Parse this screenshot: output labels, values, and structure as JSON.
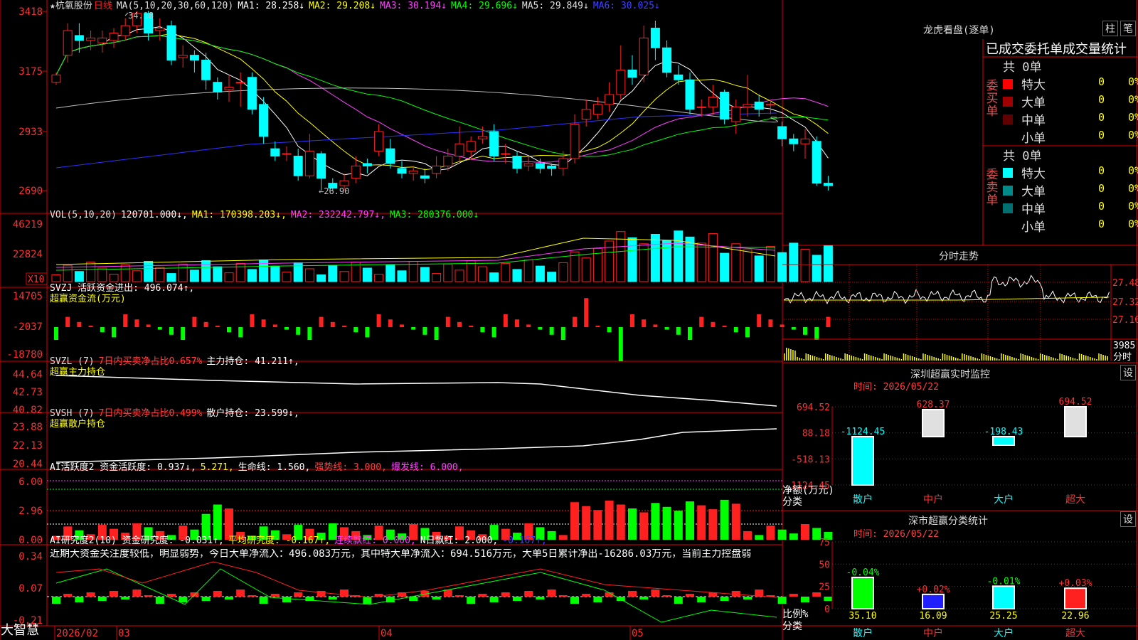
{
  "app": {
    "brand": "大智慧"
  },
  "header": {
    "stock": "★杭氧股份",
    "period": "日线",
    "ma_label": "MA(5,10,20,30,60,120)",
    "ma_values": [
      {
        "label": "MA1: 28.258↓",
        "color": "#ffffff"
      },
      {
        "label": "MA2: 29.208↓",
        "color": "#ffff00"
      },
      {
        "label": "MA3: 30.194↓",
        "color": "#ff40ff"
      },
      {
        "label": "MA4: 29.696↓",
        "color": "#00ff00"
      },
      {
        "label": "MA5: 29.849↓",
        "color": "#c0c0c0"
      },
      {
        "label": "MA6: 30.025↓",
        "color": "#4040ff"
      }
    ]
  },
  "price_axis": [
    "3418",
    "3175",
    "2933",
    "2690"
  ],
  "price_annotations": {
    "high": "34.18",
    "low": "←26.90"
  },
  "vol_pane": {
    "header": [
      {
        "label": "VOL(5,10,20)",
        "color": "#c0c0c0"
      },
      {
        "label": "120701.000↓,",
        "color": "#ffffff"
      },
      {
        "label": "MA1: 170398.203↓,",
        "color": "#ffff00"
      },
      {
        "label": "MA2: 232242.797↓,",
        "color": "#ff40ff"
      },
      {
        "label": "MA3: 280376.000↓",
        "color": "#00ff00"
      }
    ],
    "axis": [
      "46219",
      "22824"
    ],
    "unit": "X10"
  },
  "svzj_pane": {
    "header": [
      {
        "label": "SVZJ  活跃资金进出: 496.074↑,",
        "color": "#ffffff"
      }
    ],
    "subtitle": "超赢资金流(万元)",
    "axis": [
      "14705",
      "-2037",
      "-18780"
    ]
  },
  "svzl_pane": {
    "header": [
      {
        "label": "SVZL (7)",
        "color": "#c0c0c0"
      },
      {
        "label": "7日内买卖净占比0.657%",
        "color": "#ff4040"
      },
      {
        "label": "主力持仓: 41.211↑,",
        "color": "#ffffff"
      }
    ],
    "subtitle": "超赢主力持仓",
    "axis": [
      "44.64",
      "42.73",
      "40.82"
    ]
  },
  "svsh_pane": {
    "header": [
      {
        "label": "SVSH (7)",
        "color": "#c0c0c0"
      },
      {
        "label": "7日内买卖净占比0.499%",
        "color": "#ff4040"
      },
      {
        "label": "散户持仓: 23.599↓,",
        "color": "#ffffff"
      }
    ],
    "subtitle": "超赢散户持仓",
    "axis": [
      "23.88",
      "22.13",
      "20.44"
    ]
  },
  "ai_pane": {
    "header": [
      {
        "label": "AI活跃度2 资金活跃度: 0.937↓,",
        "color": "#ffffff"
      },
      {
        "label": "5.271,",
        "color": "#ffff00"
      },
      {
        "label": "生命线: 1.560,",
        "color": "#ffffff"
      },
      {
        "label": "强势线: 3.000,",
        "color": "#ff4040"
      },
      {
        "label": "爆发线: 6.000,",
        "color": "#ff40ff"
      }
    ],
    "axis": [
      "6.00",
      "2.96",
      "0.00"
    ]
  },
  "research_pane": {
    "header": [
      {
        "label": "AI研究度2(10) 资金研究度: -0.031↑,",
        "color": "#ffffff"
      },
      {
        "label": "平均研究度: -0.167↑,",
        "color": "#ffff00"
      },
      {
        "label": "连续飘红: 0.000,",
        "color": "#ff40ff"
      },
      {
        "label": "N日飘红: 2.000,",
        "color": "#ffffff"
      },
      {
        "label": "-0.167↑,",
        "color": "#4040ff"
      }
    ],
    "comment": "近期大资金关注度较低，明显弱势，今日大单净流入：496.083万元，其中特大单净流入：694.516万元，大单5日累计净出-16286.03万元，当前主力控盘弱",
    "axis": [
      "0.34",
      "0.07",
      "-0.21"
    ]
  },
  "dates": [
    "2026/02",
    "03",
    "04",
    "05"
  ],
  "longhu": {
    "title": "龙虎看盘(逐单)",
    "btn1": "柱",
    "btn2": "笔",
    "subtitle": "已成交委托单成交量统计",
    "buy_label": "委买单",
    "sell_label": "委卖单",
    "buy_total": "共 0单",
    "sell_total": "共 0单",
    "buy_rows": [
      {
        "name": "特大",
        "count": "0",
        "pct": "0%",
        "color": "#ff0000"
      },
      {
        "name": "大单",
        "count": "0",
        "pct": "0%",
        "color": "#a00000"
      },
      {
        "name": "中单",
        "count": "0",
        "pct": "0%",
        "color": "#600000"
      },
      {
        "name": "小单",
        "count": "0",
        "pct": "0%",
        "color": "#000000"
      }
    ],
    "sell_rows": [
      {
        "name": "特大",
        "count": "0",
        "pct": "0%",
        "color": "#00ffff"
      },
      {
        "name": "大单",
        "count": "0",
        "pct": "0%",
        "color": "#008a8a"
      },
      {
        "name": "中单",
        "count": "0",
        "pct": "0%",
        "color": "#007070"
      },
      {
        "name": "小单",
        "count": "0",
        "pct": "0%",
        "color": "#000000"
      }
    ]
  },
  "intraday": {
    "title": "分时走势",
    "axis": [
      "27.48",
      "27.32",
      "27.16"
    ],
    "vol": "3985",
    "vol_label": "分时"
  },
  "chart_data": [
    {
      "type": "bar",
      "title": "深圳超赢实时监控",
      "date": "时间: 2026/05/22",
      "categories": [
        "散户",
        "中户",
        "大户",
        "超大"
      ],
      "values": [
        -1124.45,
        628.37,
        -198.43,
        694.52
      ],
      "value_labels": [
        "-1124.45",
        "628.37",
        "-198.43",
        "694.52"
      ],
      "axis_ticks": [
        "694.52",
        "88.18",
        "-518.13",
        "-1124.45"
      ],
      "ylim": [
        -1124.45,
        694.52
      ],
      "ylabel": "净额(万元)",
      "xlabel": "分类",
      "setting_btn": "设"
    },
    {
      "type": "bar",
      "title": "深市超赢分类统计",
      "date": "时间: 2026/05/22",
      "categories": [
        "散户",
        "中户",
        "大户",
        "超大"
      ],
      "values": [
        35.1,
        16.09,
        25.25,
        22.96
      ],
      "value_labels": [
        "35.10",
        "16.09",
        "25.25",
        "22.96"
      ],
      "changes": [
        "-0.04%",
        "+0.02%",
        "-0.01%",
        "+0.03%"
      ],
      "axis_ticks": [
        "75",
        "50",
        "25",
        "0"
      ],
      "ylim": [
        0,
        75
      ],
      "ylabel": "比例%",
      "xlabel": "分类",
      "setting_btn": "设"
    }
  ],
  "colors": {
    "up": "#ff2020",
    "down": "#00ffff",
    "grid": "#c00000",
    "vol_up": "#ff2020",
    "vol_down": "#00ffff"
  }
}
